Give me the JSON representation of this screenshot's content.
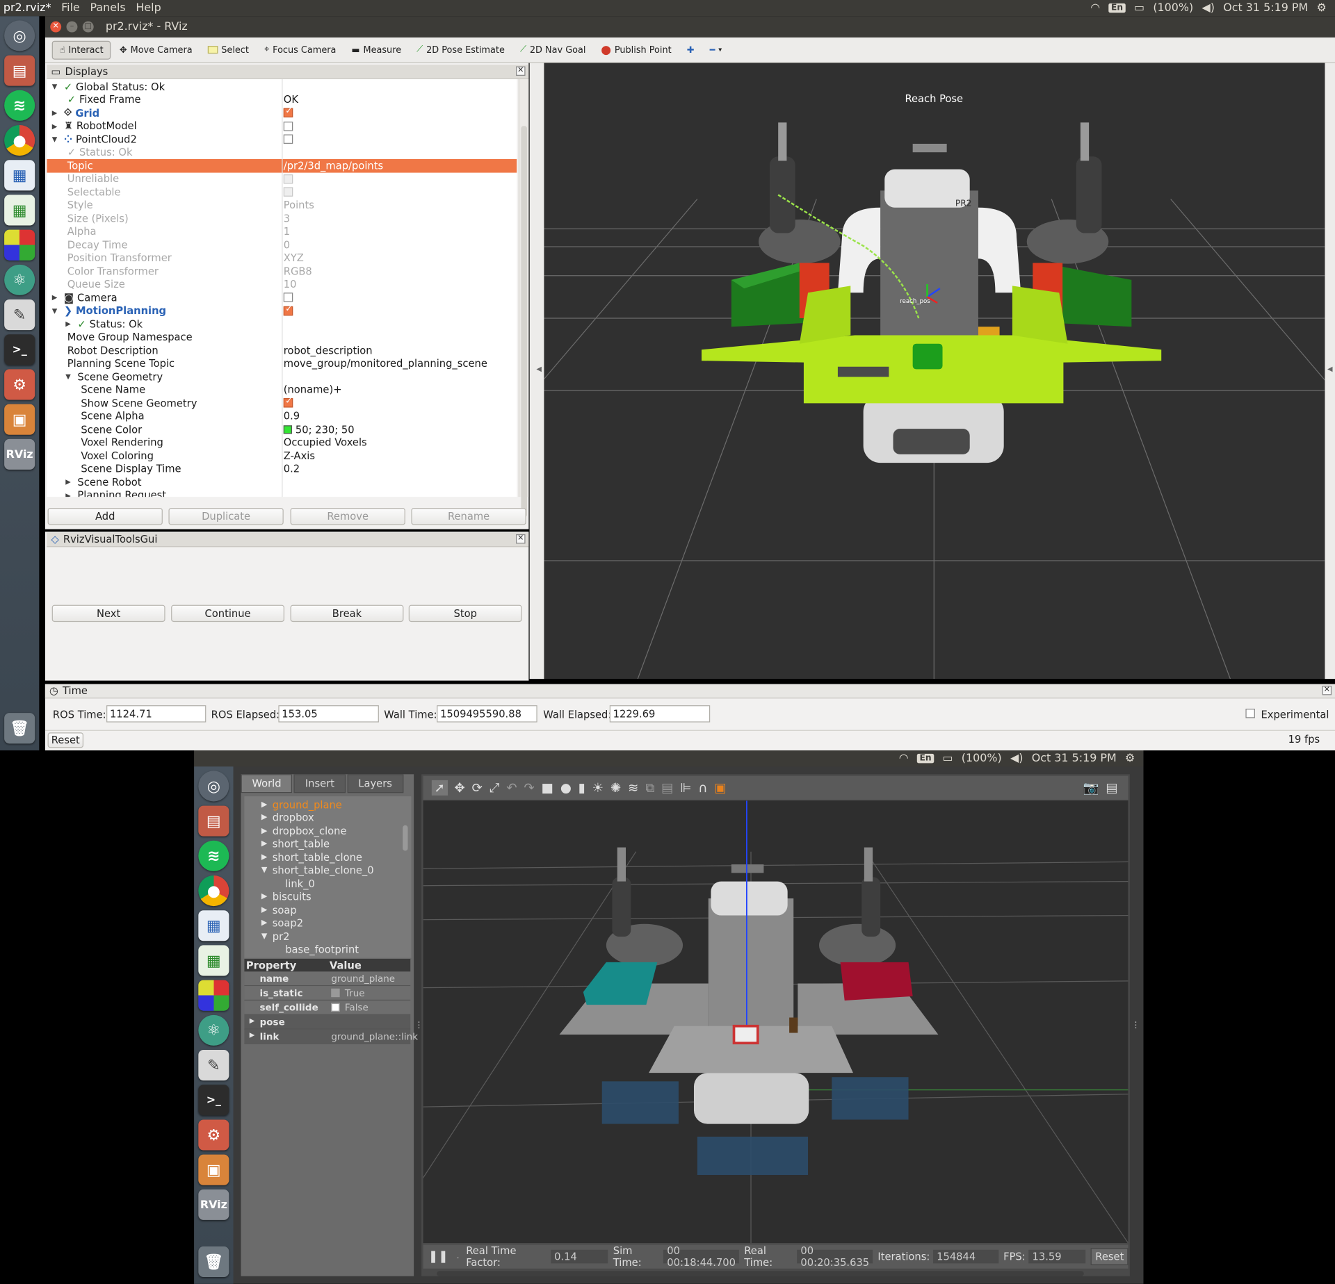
{
  "top_bar": {
    "app": "pr2.rviz*",
    "menus": [
      "File",
      "Panels",
      "Help"
    ],
    "lang": "En",
    "battery": "(100%)",
    "clock": "Oct 31  5:19 PM"
  },
  "bottom_bar": {
    "lang": "En",
    "battery": "(100%)",
    "clock": "Oct 31  5:19 PM"
  },
  "window": {
    "title": "pr2.rviz* - RViz"
  },
  "toolbar": {
    "tools": [
      "Interact",
      "Move Camera",
      "Select",
      "Focus Camera",
      "Measure",
      "2D Pose Estimate",
      "2D Nav Goal",
      "Publish Point"
    ]
  },
  "displays": {
    "title": "Displays",
    "rows": [
      {
        "name": "Global Status: Ok",
        "value": ""
      },
      {
        "name": "Fixed Frame",
        "value": "OK"
      },
      {
        "name": "Grid",
        "value": ""
      },
      {
        "name": "RobotModel",
        "value": ""
      },
      {
        "name": "PointCloud2",
        "value": ""
      },
      {
        "name": "Status: Ok",
        "value": ""
      },
      {
        "name": "Topic",
        "value": "/pr2/3d_map/points"
      },
      {
        "name": "Unreliable",
        "value": ""
      },
      {
        "name": "Selectable",
        "value": ""
      },
      {
        "name": "Style",
        "value": "Points"
      },
      {
        "name": "Size (Pixels)",
        "value": "3"
      },
      {
        "name": "Alpha",
        "value": "1"
      },
      {
        "name": "Decay Time",
        "value": "0"
      },
      {
        "name": "Position Transformer",
        "value": "XYZ"
      },
      {
        "name": "Color Transformer",
        "value": "RGB8"
      },
      {
        "name": "Queue Size",
        "value": "10"
      },
      {
        "name": "Camera",
        "value": ""
      },
      {
        "name": "MotionPlanning",
        "value": ""
      },
      {
        "name": "Status: Ok",
        "value": ""
      },
      {
        "name": "Move Group Namespace",
        "value": ""
      },
      {
        "name": "Robot Description",
        "value": "robot_description"
      },
      {
        "name": "Planning Scene Topic",
        "value": "move_group/monitored_planning_scene"
      },
      {
        "name": "Scene Geometry",
        "value": ""
      },
      {
        "name": "Scene Name",
        "value": "(noname)+"
      },
      {
        "name": "Show Scene Geometry",
        "value": ""
      },
      {
        "name": "Scene Alpha",
        "value": "0.9"
      },
      {
        "name": "Scene Color",
        "value": "50; 230; 50"
      },
      {
        "name": "Voxel Rendering",
        "value": "Occupied Voxels"
      },
      {
        "name": "Voxel Coloring",
        "value": "Z-Axis"
      },
      {
        "name": "Scene Display Time",
        "value": "0.2"
      },
      {
        "name": "Scene Robot",
        "value": ""
      },
      {
        "name": "Planning Request",
        "value": ""
      }
    ],
    "buttons": [
      "Add",
      "Duplicate",
      "Remove",
      "Rename"
    ]
  },
  "visual_tools": {
    "title": "RvizVisualToolsGui",
    "buttons": [
      "Next",
      "Continue",
      "Break",
      "Stop"
    ]
  },
  "view3d": {
    "label": "Reach  Pose",
    "marker_label": "reach_pos"
  },
  "time": {
    "title": "Time",
    "ros_time_label": "ROS Time:",
    "ros_time": "1124.71",
    "ros_elapsed_label": "ROS Elapsed:",
    "ros_elapsed": "153.05",
    "wall_time_label": "Wall Time:",
    "wall_time": "1509495590.88",
    "wall_elapsed_label": "Wall Elapsed:",
    "wall_elapsed": "1229.69",
    "experimental": "Experimental",
    "reset": "Reset",
    "fps": "19 fps"
  },
  "gazebo": {
    "tabs": [
      "World",
      "Insert",
      "Layers"
    ],
    "tree": [
      {
        "label": "ground_plane",
        "indent": 0,
        "expander": "right",
        "selected": true
      },
      {
        "label": "dropbox",
        "indent": 0,
        "expander": "right"
      },
      {
        "label": "dropbox_clone",
        "indent": 0,
        "expander": "right"
      },
      {
        "label": "short_table",
        "indent": 0,
        "expander": "right"
      },
      {
        "label": "short_table_clone",
        "indent": 0,
        "expander": "right"
      },
      {
        "label": "short_table_clone_0",
        "indent": 0,
        "expander": "down"
      },
      {
        "label": "link_0",
        "indent": 1,
        "expander": "none"
      },
      {
        "label": "biscuits",
        "indent": 0,
        "expander": "right"
      },
      {
        "label": "soap",
        "indent": 0,
        "expander": "right"
      },
      {
        "label": "soap2",
        "indent": 0,
        "expander": "right"
      },
      {
        "label": "pr2",
        "indent": 0,
        "expander": "down"
      },
      {
        "label": "base_footprint",
        "indent": 1,
        "expander": "none"
      }
    ],
    "prop_headers": [
      "Property",
      "Value"
    ],
    "props": [
      {
        "name": "name",
        "value": "ground_plane"
      },
      {
        "name": "is_static",
        "value": "True"
      },
      {
        "name": "self_collide",
        "value": "False"
      },
      {
        "name": "pose",
        "value": ""
      },
      {
        "name": "link",
        "value": "ground_plane::link"
      }
    ],
    "status": {
      "rtf_label": "Real Time Factor:",
      "rtf": "0.14",
      "sim_label": "Sim Time:",
      "sim": "00 00:18:44.700",
      "real_label": "Real Time:",
      "real": "00 00:20:35.635",
      "iter_label": "Iterations:",
      "iter": "154844",
      "fps_label": "FPS:",
      "fps": "13.59",
      "reset": "Reset"
    }
  },
  "colors": {
    "selection": "#f07746",
    "voxel_green": "#b5e61d",
    "ubuntu_bar": "#3c3b37"
  }
}
